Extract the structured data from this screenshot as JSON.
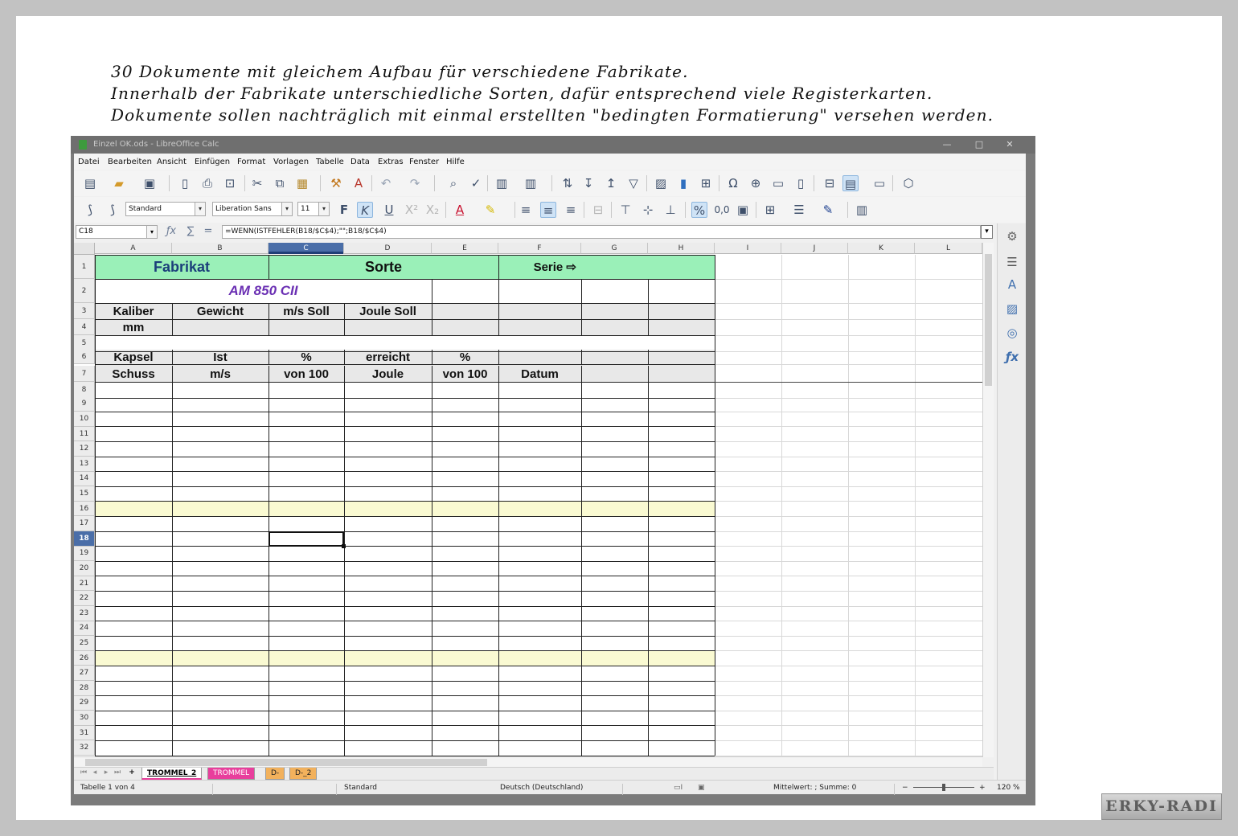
{
  "intro_lines": [
    "30 Dokumente mit gleichem Aufbau für verschiedene Fabrikate.",
    "Innerhalb der Fabrikate unterschiedliche Sorten, dafür entsprechend viele Registerkarten.",
    "Dokumente sollen nachträglich mit einmal erstellten \"bedingten Formatierung\" versehen werden."
  ],
  "window": {
    "title": "Einzel OK.ods - LibreOffice Calc",
    "controls": [
      "—",
      "□",
      "✕"
    ]
  },
  "menu": [
    "Datei",
    "Bearbeiten",
    "Ansicht",
    "Einfügen",
    "Format",
    "Vorlagen",
    "Tabelle",
    "Data",
    "Extras",
    "Fenster",
    "Hilfe"
  ],
  "format_bar": {
    "para_style": "Standard",
    "font_name": "Liberation Sans",
    "font_size": "11"
  },
  "formula_bar": {
    "cell_ref": "C18",
    "formula": "=WENN(ISTFEHLER(B18/$C$4);\"\";B18/$C$4)"
  },
  "columns": [
    "A",
    "B",
    "C",
    "D",
    "E",
    "F",
    "G",
    "H",
    "I",
    "J",
    "K",
    "L"
  ],
  "selected_column": "C",
  "selected_row": "18",
  "rows": [
    "1",
    "2",
    "3",
    "4",
    "5",
    "6",
    "7",
    "8",
    "9",
    "10",
    "11",
    "12",
    "13",
    "14",
    "15",
    "16",
    "17",
    "18",
    "19",
    "20",
    "21",
    "22",
    "23",
    "24",
    "25",
    "26",
    "27",
    "28",
    "29",
    "30",
    "31",
    "32"
  ],
  "cells": {
    "fabrikat": "Fabrikat",
    "sorte": "Sorte",
    "serie": "Serie ⇨",
    "model": "AM 850 CII",
    "kaliber": "Kaliber",
    "mm": "mm",
    "gewicht": "Gewicht",
    "ms_soll": "m/s Soll",
    "joule_soll": "Joule Soll",
    "kapsel": "Kapsel",
    "schuss": "Schuss",
    "ist": "Ist",
    "ms": "m/s",
    "pct1": "%",
    "von100_1": "von 100",
    "erreicht": "erreicht",
    "joule": "Joule",
    "pct2": "%",
    "von100_2": "von 100",
    "datum": "Datum"
  },
  "sheet_tabs": [
    {
      "label": "TROMMEL_2",
      "bg": "#ffffff",
      "color": "#000000",
      "active": true
    },
    {
      "label": "TROMMEL",
      "bg": "#e83e9c",
      "color": "#ffffff",
      "active": false
    },
    {
      "label": "D-",
      "bg": "#f2b15c",
      "color": "#222222",
      "active": false
    },
    {
      "label": "D-_2",
      "bg": "#f2b15c",
      "color": "#222222",
      "active": false
    }
  ],
  "status": {
    "sheet_info": "Tabelle 1 von 4",
    "page_style": "Standard",
    "language": "Deutsch (Deutschland)",
    "stats": "Mittelwert: ; Summe: 0",
    "zoom": "120 %"
  },
  "colors": {
    "header_green": "#9af0b8",
    "gray_band": "#e8e8e8",
    "yellow_row": "#fafad2",
    "model_purple": "#6a2fb3",
    "fabrikat_blue": "#1b3f7a"
  },
  "watermark": "ERKY-RADI"
}
